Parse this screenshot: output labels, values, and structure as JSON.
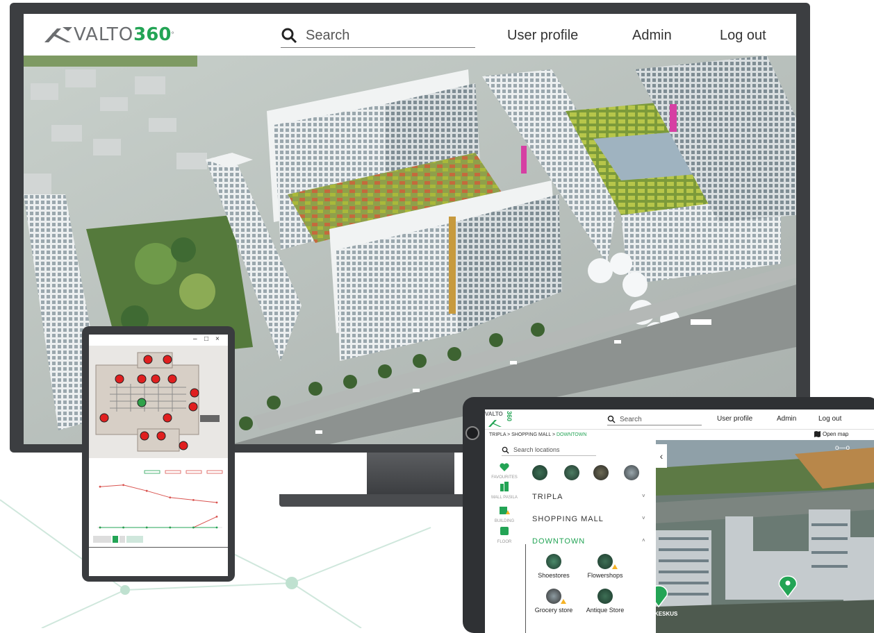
{
  "monitor": {
    "logo": {
      "word": "VALTO",
      "number": "360",
      "mark": "°"
    },
    "search": {
      "placeholder": "Search"
    },
    "nav": {
      "user_profile": "User profile",
      "admin": "Admin",
      "logout": "Log out"
    }
  },
  "small_tablet": {
    "window_controls": {
      "minimize": "–",
      "maximize": "□",
      "close": "×"
    },
    "chart_data": {
      "type": "line",
      "series": [
        {
          "values": [
            9.8,
            10.2,
            8.8,
            7.2,
            6.6,
            6.0
          ],
          "color": "#d9534f"
        },
        {
          "values": [
            0,
            0,
            0,
            0,
            0,
            2.6
          ],
          "color": "#d9534f"
        },
        {
          "values": [
            0,
            0,
            0,
            0,
            0,
            0
          ],
          "color": "#23a455"
        }
      ],
      "ylim": [
        0,
        12
      ],
      "legend_colors": [
        "#23a455",
        "#d9534f",
        "#d9534f",
        "#d9534f"
      ]
    }
  },
  "ipad": {
    "logo": {
      "word": "VALTO",
      "number": "360"
    },
    "search": {
      "placeholder": "Search"
    },
    "nav": {
      "user_profile": "User profile",
      "admin": "Admin",
      "logout": "Log out"
    },
    "breadcrumb": {
      "path": "TRIPLA > SHOPPING MALL > ",
      "current": "DOWNTOWN"
    },
    "open_map": "Open map",
    "location_search": {
      "placeholder": "Search locations"
    },
    "rail": [
      {
        "label": "FAVOURITES",
        "icon": "heart-icon"
      },
      {
        "label": "MALL PASILA",
        "icon": "buildings-icon"
      },
      {
        "label": "BUILDING",
        "icon": "building-icon"
      },
      {
        "label": "FLOOR",
        "icon": "floor-icon"
      }
    ],
    "accordion": [
      {
        "label": "TRIPLA",
        "caret": "˅",
        "expanded": false
      },
      {
        "label": "SHOPPING MALL",
        "caret": "˅",
        "expanded": false
      },
      {
        "label": "DOWNTOWN",
        "caret": "˄",
        "expanded": true
      }
    ],
    "categories": [
      {
        "name": "Shoestores",
        "warning": false
      },
      {
        "name": "Flowershops",
        "warning": true
      },
      {
        "name": "Grocery store",
        "warning": true
      },
      {
        "name": "Antique Store",
        "warning": false
      }
    ],
    "collapse_icon": "‹",
    "toggle_icon": "o—o",
    "map_label": "KESKUS",
    "accent": "#23a455"
  }
}
